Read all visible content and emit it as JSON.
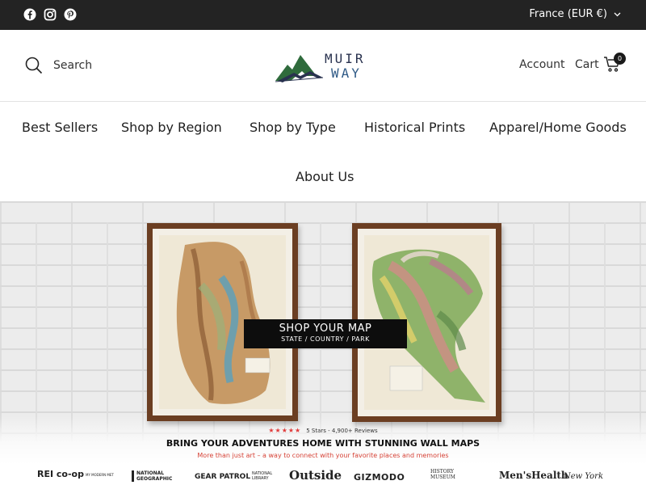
{
  "topbar": {
    "social_icons": [
      "facebook-icon",
      "instagram-icon",
      "pinterest-icon"
    ],
    "locale_label": "France (EUR €)"
  },
  "header": {
    "search_label": "Search",
    "logo_line1": "MUIR",
    "logo_line2": "WAY",
    "account_label": "Account",
    "cart_label": "Cart",
    "cart_count": "0"
  },
  "nav": {
    "items": [
      "Best Sellers",
      "Shop by Region",
      "Shop by Type",
      "Historical Prints",
      "Apparel/Home Goods",
      "About Us"
    ]
  },
  "hero": {
    "cta_line1": "SHOP YOUR MAP",
    "cta_line2": "STATE / COUNTRY / PARK",
    "stars": "★★★★★",
    "reviews": "5 Stars - 4,900+ Reviews",
    "tagline": "BRING YOUR ADVENTURES HOME WITH STUNNING WALL MAPS",
    "subline": "More than just art – a way to connect with your favorite places and memories"
  },
  "press": {
    "logos": [
      "REI co-op",
      "MY MODERN MET",
      "NATIONAL GEOGRAPHIC",
      "GEAR PATROL",
      "NATIONAL LIBRARY",
      "Outside",
      "GIZMODO",
      "HISTORY MUSEUM",
      "Men'sHealth",
      "New York"
    ]
  },
  "colors": {
    "topbar_bg": "#232323",
    "logo_navy": "#29324f",
    "logo_green": "#2f6b3c",
    "accent_red": "#d64236"
  }
}
